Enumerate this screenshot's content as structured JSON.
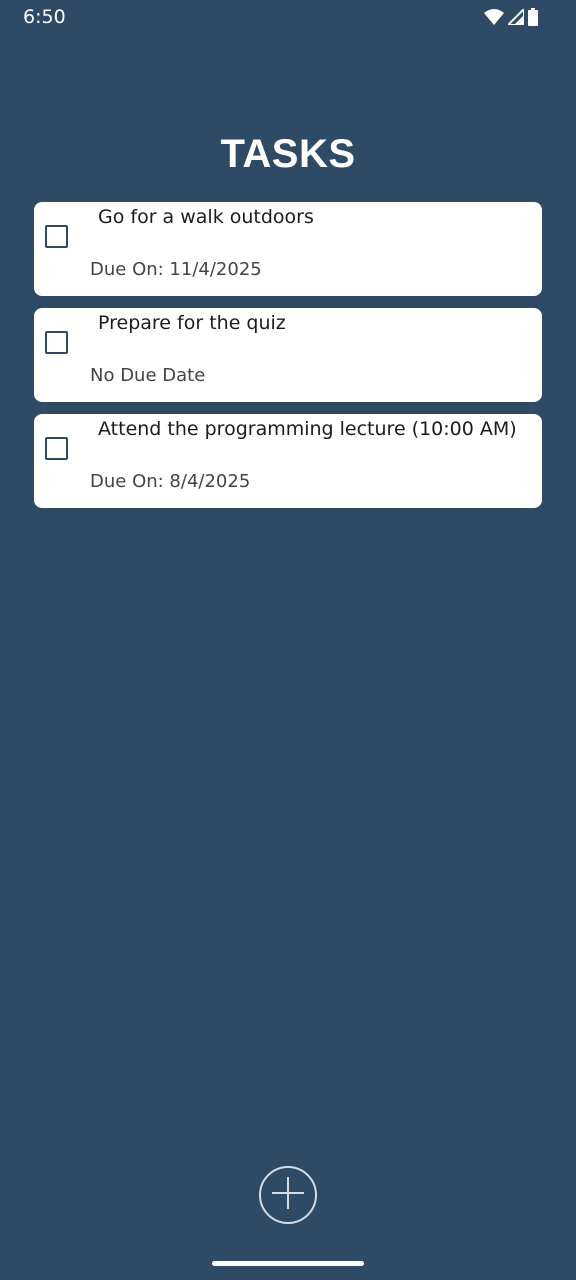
{
  "status_bar": {
    "time": "6:50",
    "icons": [
      "wifi-icon",
      "signal-icon",
      "battery-icon"
    ]
  },
  "header": {
    "title": "TASKS"
  },
  "tasks": [
    {
      "title": "Go for a walk outdoors",
      "due": "Due On: 11/4/2025",
      "checked": false
    },
    {
      "title": "Prepare for the quiz",
      "due": "No Due Date",
      "checked": false
    },
    {
      "title": "Attend the programming lecture (10:00 AM)",
      "due": "Due On: 8/4/2025",
      "checked": false
    }
  ],
  "fab": {
    "icon": "plus-icon"
  },
  "colors": {
    "background": "#2e4a65",
    "card": "#ffffff",
    "text": "#1c1c1c",
    "accent": "#2e4a65"
  }
}
